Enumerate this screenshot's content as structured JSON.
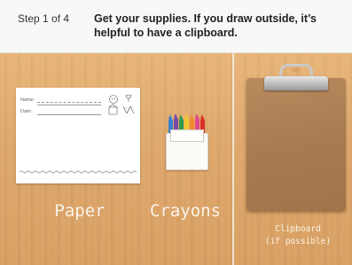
{
  "header": {
    "step_label": "Step 1 of 4",
    "title": "Get your supplies. If you draw outside, it’s helpful to have a clipboard."
  },
  "items": {
    "paper": {
      "label": "Paper",
      "name_field": "Name:",
      "date_field": "Date:"
    },
    "crayons": {
      "label": "Crayons"
    },
    "clipboard": {
      "label_line1": "Clipboard",
      "label_line2": "(if possible)"
    }
  },
  "colors": {
    "wood": "#dea66a",
    "clipboard": "#a97b50",
    "label_text": "#f9f3e8"
  }
}
